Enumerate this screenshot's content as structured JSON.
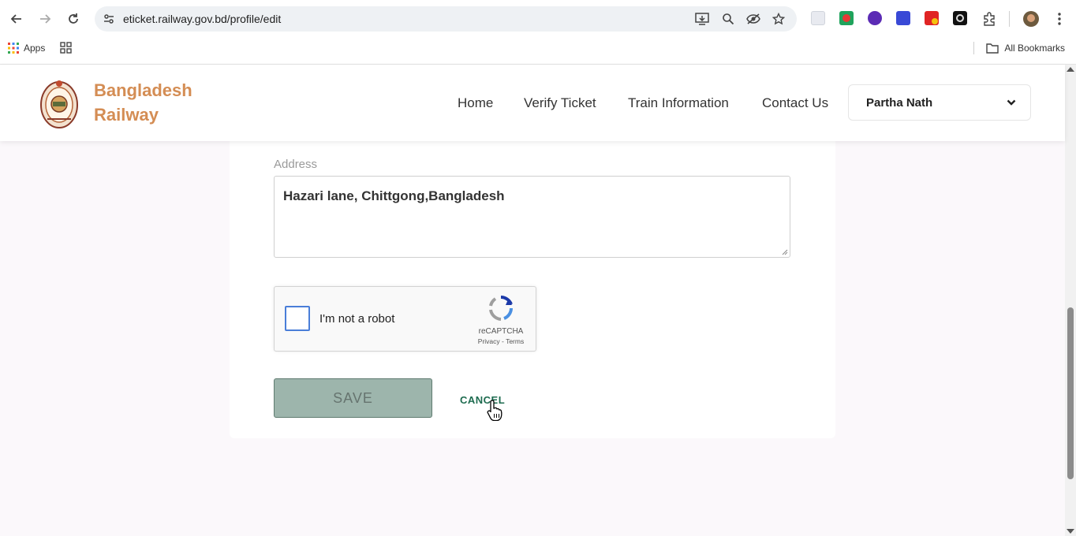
{
  "browser": {
    "url": "eticket.railway.gov.bd/profile/edit",
    "bookmarks": {
      "apps_label": "Apps",
      "all_bookmarks_label": "All Bookmarks"
    }
  },
  "header": {
    "brand_line1": "Bangladesh",
    "brand_line2": "Railway",
    "nav": {
      "home": "Home",
      "verify_ticket": "Verify Ticket",
      "train_information": "Train Information",
      "contact_us": "Contact Us"
    },
    "user_name": "Partha Nath"
  },
  "form": {
    "address_label": "Address",
    "address_value": "Hazari lane, Chittgong,Bangladesh",
    "captcha": {
      "label": "I'm not a robot",
      "brand": "reCAPTCHA",
      "privacy": "Privacy",
      "separator": " - ",
      "terms": "Terms"
    },
    "save_label": "SAVE",
    "cancel_label": "CANCEL"
  },
  "colors": {
    "brand": "#d48d54",
    "save_bg": "#9db5ac",
    "cancel_text": "#1d6b4f",
    "captcha_border": "#4a7ed8"
  }
}
